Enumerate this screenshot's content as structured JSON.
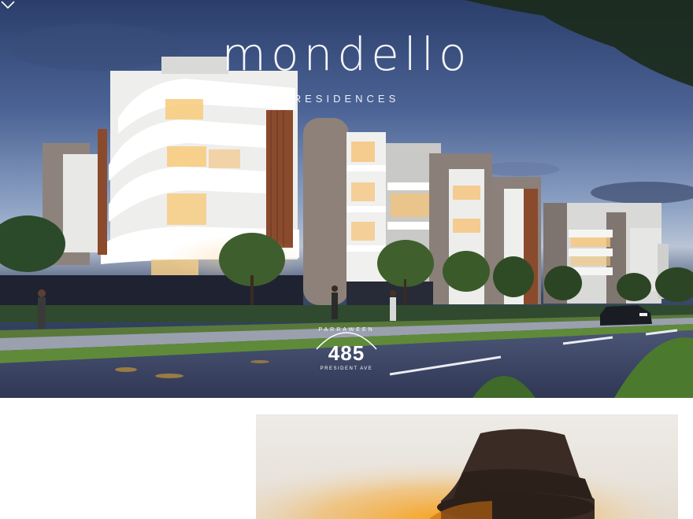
{
  "brand": {
    "name": "mondello",
    "tagline": "RESIDENCES"
  },
  "address_badge": {
    "label": "PARRAWEEN",
    "number": "485",
    "street": "PRESIDENT AVE"
  },
  "icons": {
    "scroll": "chevron-down-icon"
  },
  "colors": {
    "sky_top": "#2b3e6b",
    "sky_mid": "#8ea3c4",
    "road": "#3b4563",
    "building_white": "#f2f2f0",
    "brick": "#8f847c",
    "timber": "#8a4a2c"
  }
}
